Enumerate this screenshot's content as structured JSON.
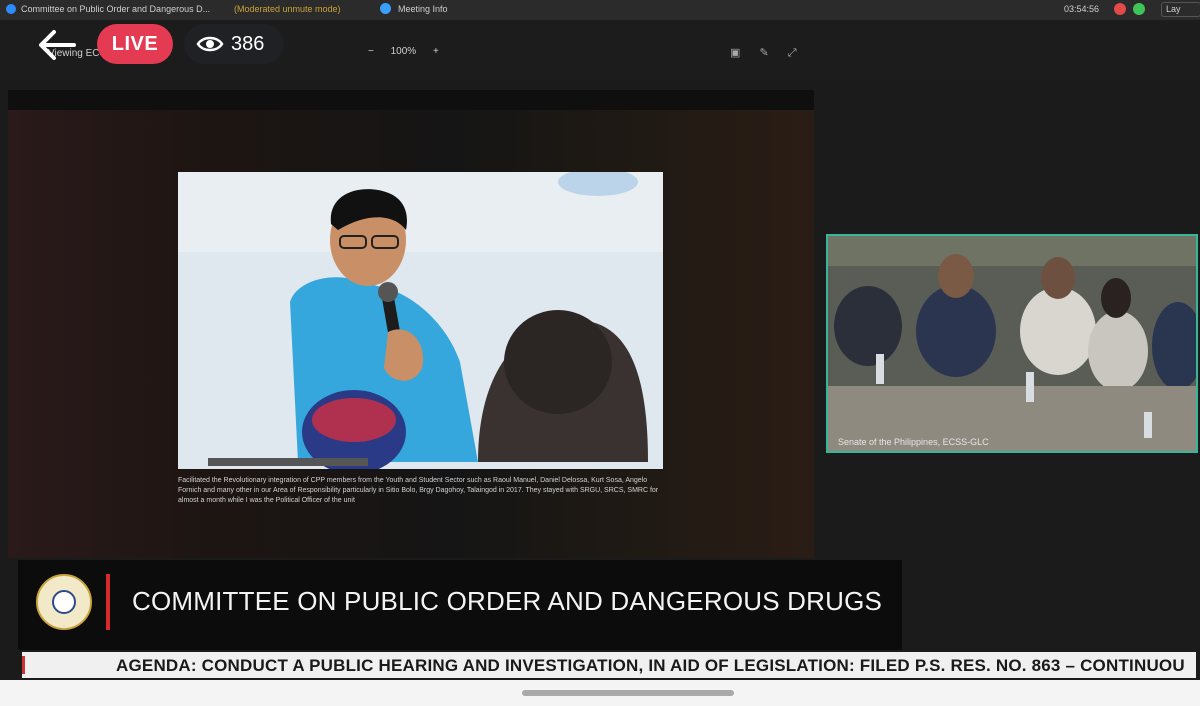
{
  "window": {
    "title": "Committee on Public Order and Dangerous D...",
    "mode": "(Moderated unmute mode)",
    "meeting_info": "Meeting Info",
    "clock": "03:54:56",
    "layout_label": "Lay"
  },
  "viewbar": {
    "view_label": "Viewing ECSS-GLC's...",
    "zoom_minus": "−",
    "zoom_level": "100%",
    "zoom_plus": "+"
  },
  "overlay": {
    "live_label": "LIVE",
    "viewer_count": "386"
  },
  "slide": {
    "photo_credit": "PHOTO COURTESY OF FACEBOOK.COM/ANAKBAYAN",
    "caption": "Facilitated the Revolutionary integration of CPP members from the Youth and Student Sector such as Raoul Manuel, Daniel Delossa, Kurt Sosa, Angelo Fornich and many other in our Area of Responsibility particularly in Sitio Bolo, Brgy Dagohoy, Talaingod in 2017. They stayed with SRGU, SRCS, SMRC for almost a month while I was the Political Officer of the unit"
  },
  "inset": {
    "label": "Senate of the Philippines, ECSS-GLC"
  },
  "banner": {
    "title": "COMMITTEE ON PUBLIC ORDER AND DANGEROUS DRUGS"
  },
  "agenda": {
    "text": "AGENDA:  CONDUCT A PUBLIC HEARING AND INVESTIGATION, IN AID OF LEGISLATION: FILED P.S. RES. NO. 863 – CONTINUOU"
  },
  "colors": {
    "live": "#e43a52",
    "accent_border": "#39b59a",
    "banner_red": "#d62a2a"
  }
}
